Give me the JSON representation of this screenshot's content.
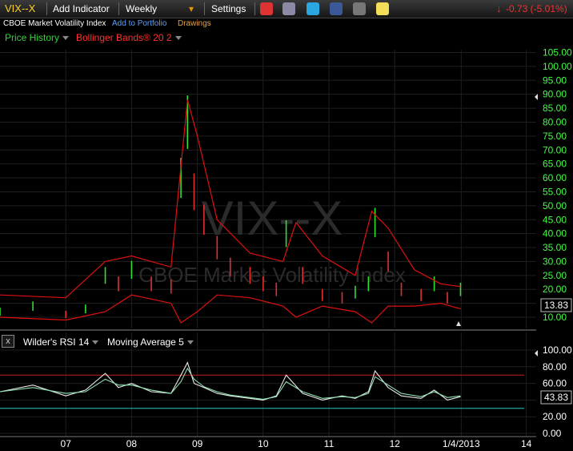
{
  "toolbar": {
    "symbol": "VIX--X",
    "add_indicator": "Add Indicator",
    "period": "Weekly",
    "settings": "Settings",
    "change": "-0.73 (-5.01%)",
    "icons": [
      "alarm-icon",
      "print-icon",
      "twitter-icon",
      "facebook-icon",
      "binoculars-icon",
      "note-icon"
    ],
    "colors": {
      "change": "#ff2a2a",
      "symbol": "#ffd21e"
    }
  },
  "subbar": {
    "description": "CBOE Market Volatility Index",
    "add_portfolio": "Add to Portfolio",
    "drawings": "Drawings"
  },
  "price_legend": {
    "series": "Price History",
    "overlay": "Bollinger Bands® 20 2"
  },
  "rsi_legend": {
    "series": "Wilder's RSI 14",
    "overlay": "Moving Average 5"
  },
  "watermark": {
    "symbol": "VIX--X",
    "name": "CBOE Market Volatility Index"
  },
  "chart_data": [
    {
      "type": "bar",
      "title": "",
      "ylim": [
        8,
        106
      ],
      "yticks": [
        "105.00",
        "100.00",
        "95.00",
        "90.00",
        "85.00",
        "80.00",
        "75.00",
        "70.00",
        "65.00",
        "60.00",
        "55.00",
        "50.00",
        "45.00",
        "40.00",
        "35.00",
        "30.00",
        "25.00",
        "20.00",
        "15.00",
        "10.00"
      ],
      "last_value": "13.83",
      "series": [
        {
          "name": "Price History",
          "x": [
            2006.0,
            2006.5,
            2007.0,
            2007.3,
            2007.6,
            2007.8,
            2008.0,
            2008.3,
            2008.6,
            2008.75,
            2008.85,
            2008.95,
            2009.1,
            2009.3,
            2009.5,
            2009.8,
            2010.0,
            2010.2,
            2010.35,
            2010.6,
            2010.9,
            2011.2,
            2011.4,
            2011.6,
            2011.7,
            2011.9,
            2012.1,
            2012.4,
            2012.6,
            2012.8,
            2013.0
          ],
          "values": [
            12,
            14,
            11,
            13,
            25,
            22,
            27,
            22,
            21,
            60,
            80,
            55,
            45,
            35,
            28,
            25,
            22,
            20,
            40,
            25,
            18,
            17,
            19,
            22,
            44,
            30,
            20,
            18,
            22,
            17,
            20
          ]
        },
        {
          "name": "Bollinger Bands® 20 2 upper",
          "x": [
            2006.0,
            2007.0,
            2007.6,
            2008.0,
            2008.6,
            2008.85,
            2009.0,
            2009.3,
            2009.8,
            2010.3,
            2010.5,
            2010.9,
            2011.4,
            2011.65,
            2011.9,
            2012.3,
            2012.7,
            2013.0
          ],
          "values": [
            18,
            17,
            30,
            32,
            28,
            88,
            75,
            45,
            33,
            30,
            44,
            32,
            25,
            48,
            42,
            27,
            22,
            21
          ]
        },
        {
          "name": "Bollinger Bands® 20 2 lower",
          "x": [
            2006.0,
            2007.0,
            2007.6,
            2008.0,
            2008.6,
            2008.75,
            2009.0,
            2009.3,
            2009.8,
            2010.3,
            2010.5,
            2010.9,
            2011.4,
            2011.65,
            2011.9,
            2012.3,
            2012.7,
            2013.0
          ],
          "values": [
            10,
            9,
            12,
            18,
            15,
            8,
            12,
            18,
            17,
            14,
            10,
            14,
            12,
            8,
            14,
            14,
            15,
            13
          ]
        }
      ]
    },
    {
      "type": "line",
      "title": "",
      "ylim": [
        0,
        100
      ],
      "yticks": [
        "100.00",
        "80.00",
        "60.00",
        "40.00",
        "20.00",
        "0.00"
      ],
      "reference_lines": [
        70,
        30
      ],
      "last_value": "43.83",
      "series": [
        {
          "name": "Wilder's RSI 14",
          "x": [
            2006.0,
            2006.5,
            2007.0,
            2007.3,
            2007.6,
            2007.8,
            2008.0,
            2008.3,
            2008.6,
            2008.75,
            2008.85,
            2008.95,
            2009.1,
            2009.3,
            2009.5,
            2009.8,
            2010.0,
            2010.2,
            2010.35,
            2010.6,
            2010.9,
            2011.2,
            2011.4,
            2011.6,
            2011.7,
            2011.9,
            2012.1,
            2012.4,
            2012.6,
            2012.8,
            2013.0
          ],
          "values": [
            50,
            58,
            45,
            52,
            72,
            55,
            60,
            50,
            48,
            70,
            85,
            60,
            55,
            48,
            45,
            42,
            40,
            45,
            70,
            48,
            40,
            45,
            42,
            50,
            75,
            55,
            45,
            42,
            52,
            40,
            44
          ]
        },
        {
          "name": "Moving Average 5",
          "x": [
            2006.0,
            2006.5,
            2007.0,
            2007.3,
            2007.6,
            2007.8,
            2008.0,
            2008.3,
            2008.6,
            2008.75,
            2008.85,
            2008.95,
            2009.1,
            2009.3,
            2009.5,
            2009.8,
            2010.0,
            2010.2,
            2010.35,
            2010.6,
            2010.9,
            2011.2,
            2011.4,
            2011.6,
            2011.7,
            2011.9,
            2012.1,
            2012.4,
            2012.6,
            2012.8,
            2013.0
          ],
          "values": [
            50,
            55,
            48,
            50,
            65,
            58,
            58,
            52,
            48,
            62,
            78,
            65,
            56,
            50,
            46,
            43,
            41,
            44,
            62,
            50,
            42,
            44,
            43,
            48,
            68,
            58,
            48,
            44,
            50,
            43,
            45
          ]
        }
      ]
    }
  ],
  "x_axis": {
    "labels": [
      "07",
      "08",
      "09",
      "10",
      "11",
      "12",
      "1/4/2013",
      "14"
    ],
    "values": [
      2007,
      2008,
      2009,
      2010,
      2011,
      2012,
      2013.01,
      2014
    ]
  }
}
